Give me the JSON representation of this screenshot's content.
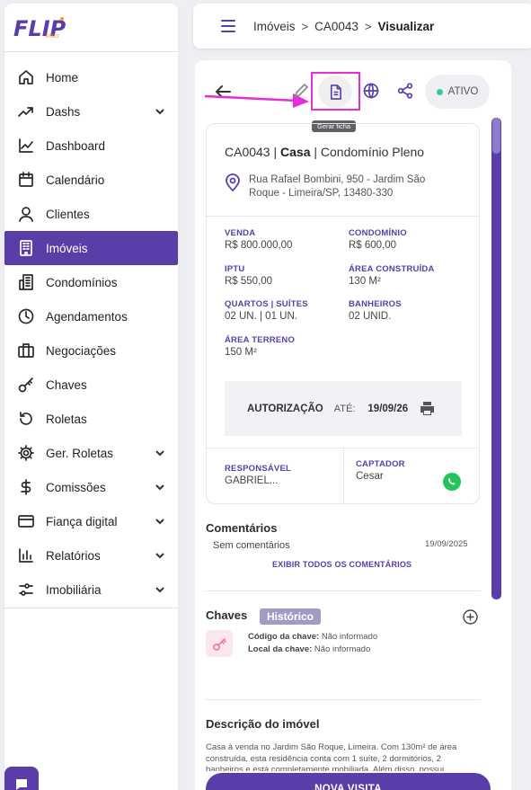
{
  "brand": {
    "logo_text": "FLIP",
    "logo_sub": "effect",
    "accent": "#5a3ea8"
  },
  "sidebar": {
    "items": [
      {
        "label": "Home",
        "icon": "home-icon",
        "chevron": false
      },
      {
        "label": "Dashs",
        "icon": "trending-up-icon",
        "chevron": true
      },
      {
        "label": "Dashboard",
        "icon": "line-chart-icon",
        "chevron": false
      },
      {
        "label": "Calendário",
        "icon": "calendar-icon",
        "chevron": false
      },
      {
        "label": "Clientes",
        "icon": "user-icon",
        "chevron": false
      },
      {
        "label": "Imóveis",
        "icon": "building-icon",
        "chevron": false,
        "active": true
      },
      {
        "label": "Condomínios",
        "icon": "condominium-icon",
        "chevron": false
      },
      {
        "label": "Agendamentos",
        "icon": "clock-icon",
        "chevron": false
      },
      {
        "label": "Negociações",
        "icon": "briefcase-icon",
        "chevron": false
      },
      {
        "label": "Chaves",
        "icon": "key-icon",
        "chevron": false
      },
      {
        "label": "Roletas",
        "icon": "rotate-icon",
        "chevron": false
      },
      {
        "label": "Ger. Roletas",
        "icon": "gear-icon",
        "chevron": true
      },
      {
        "label": "Comissões",
        "icon": "dollar-icon",
        "chevron": true
      },
      {
        "label": "Fiança digital",
        "icon": "credit-card-icon",
        "chevron": true
      },
      {
        "label": "Relatórios",
        "icon": "bar-chart-icon",
        "chevron": true
      },
      {
        "label": "Imobiliária",
        "icon": "sliders-icon",
        "chevron": true
      }
    ]
  },
  "header": {
    "breadcrumb": [
      "Imóveis",
      "CA0043",
      "Visualizar"
    ],
    "separator": ">"
  },
  "actions": {
    "tooltip": "Gerar ficha",
    "status": "ATIVO",
    "status_color": "#34c99a",
    "highlight_color": "#e52ed8"
  },
  "property": {
    "code": "CA0043",
    "type": "Casa",
    "subtype": "Condomínio Pleno",
    "address": "Rua Rafael Bombini, 950 - Jardim São Roque - Limeira/SP, 13480-330",
    "fields": {
      "venda": {
        "label": "VENDA",
        "value": "R$ 800.000,00"
      },
      "condominio": {
        "label": "CONDOMÍNIO",
        "value": "R$ 600,00"
      },
      "iptu": {
        "label": "IPTU",
        "value": "R$ 550,00"
      },
      "area_construida": {
        "label": "ÁREA CONSTRUÍDA",
        "value": "130 M²"
      },
      "quartos": {
        "label": "QUARTOS | SUÍTES",
        "value": "02 UN. | 01 UN."
      },
      "banheiros": {
        "label": "BANHEIROS",
        "value": "02 UNID."
      },
      "area_terreno": {
        "label": "ÁREA TERRENO",
        "value": "150 M²"
      }
    },
    "authorization": {
      "label": "AUTORIZAÇÃO",
      "ate": "ATÉ:",
      "date": "19/09/26"
    },
    "responsavel": {
      "label": "RESPONSÁVEL",
      "value": "GABRIEL..."
    },
    "captador": {
      "label": "CAPTADOR",
      "value": "Cesar"
    }
  },
  "comments": {
    "title": "Comentários",
    "empty": "Sem comentários",
    "date": "19/09/2025",
    "show_all": "EXIBIR TODOS OS COMENTÁRIOS"
  },
  "keys": {
    "title": "Chaves",
    "history": "Histórico",
    "code_label": "Código da chave:",
    "code_value": "Não informado",
    "local_label": "Local da chave:",
    "local_value": "Não informado"
  },
  "description": {
    "title": "Descrição do imóvel",
    "text": "Casa à venda no Jardim São Roque, Limeira. Com 130m² de área construída, esta residência conta com 1 suíte, 2 dormitórios, 2 banheiros e está completamente mobiliada. Além disso, possui"
  },
  "new_visit": "NOVA VISITA"
}
